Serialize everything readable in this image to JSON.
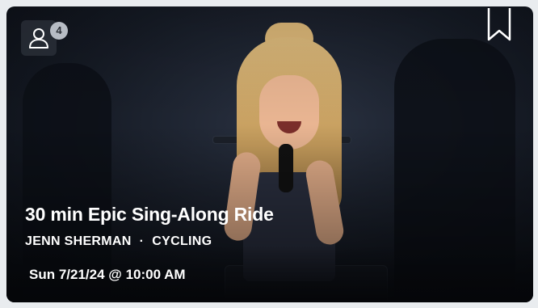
{
  "card": {
    "title": "30 min Epic Sing-Along Ride",
    "instructor": "JENN SHERMAN",
    "separator": "·",
    "discipline": "CYCLING",
    "scheduled": "Sun 7/21/24 @ 10:00 AM",
    "attendees_count": "4",
    "icons": {
      "attendees": "user-icon",
      "bookmark": "bookmark-icon"
    },
    "colors": {
      "text": "#ffffff",
      "badge_bg": "#b7bcc4",
      "page_bg": "#e9ecef"
    }
  }
}
